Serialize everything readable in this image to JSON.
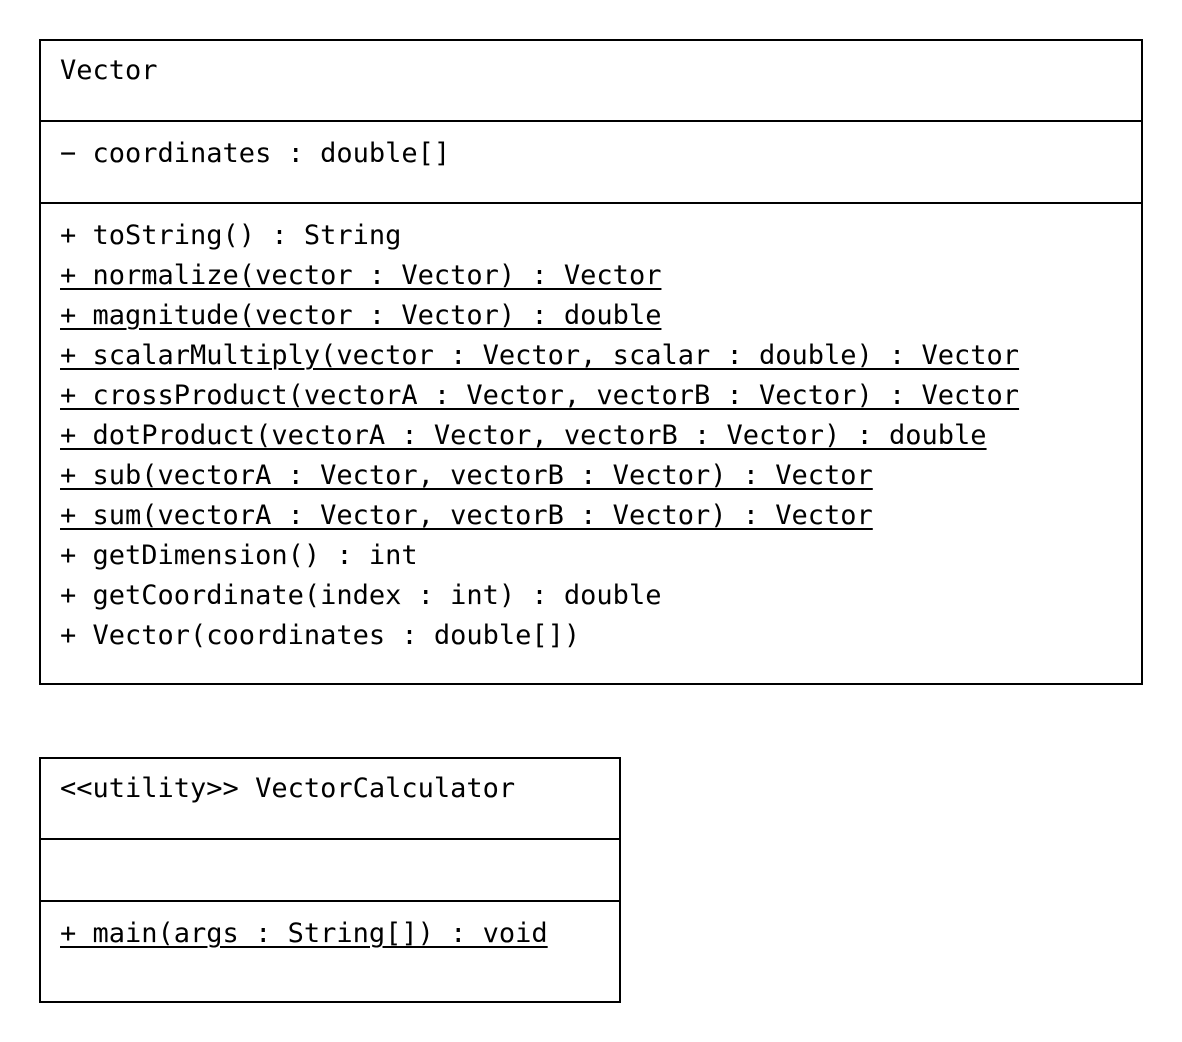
{
  "classes": [
    {
      "name": "Vector",
      "attributes": [
        {
          "text": "− coordinates : double[]",
          "static": false
        }
      ],
      "operations": [
        {
          "text": "+ toString() : String",
          "static": false
        },
        {
          "text": "+ normalize(vector : Vector) : Vector",
          "static": true
        },
        {
          "text": "+ magnitude(vector : Vector) : double",
          "static": true
        },
        {
          "text": "+ scalarMultiply(vector : Vector, scalar : double) : Vector",
          "static": true
        },
        {
          "text": "+ crossProduct(vectorA : Vector, vectorB : Vector) : Vector",
          "static": true
        },
        {
          "text": "+ dotProduct(vectorA : Vector, vectorB : Vector) : double",
          "static": true
        },
        {
          "text": "+ sub(vectorA : Vector, vectorB : Vector) : Vector",
          "static": true
        },
        {
          "text": "+ sum(vectorA : Vector, vectorB : Vector) : Vector",
          "static": true
        },
        {
          "text": "+ getDimension() : int",
          "static": false
        },
        {
          "text": "+ getCoordinate(index : int) : double",
          "static": false
        },
        {
          "text": "+ Vector(coordinates : double[])",
          "static": false
        }
      ]
    },
    {
      "name": "<<utility>> VectorCalculator",
      "attributes": [],
      "operations": [
        {
          "text": "+ main(args : String[]) : void",
          "static": true
        }
      ]
    }
  ]
}
